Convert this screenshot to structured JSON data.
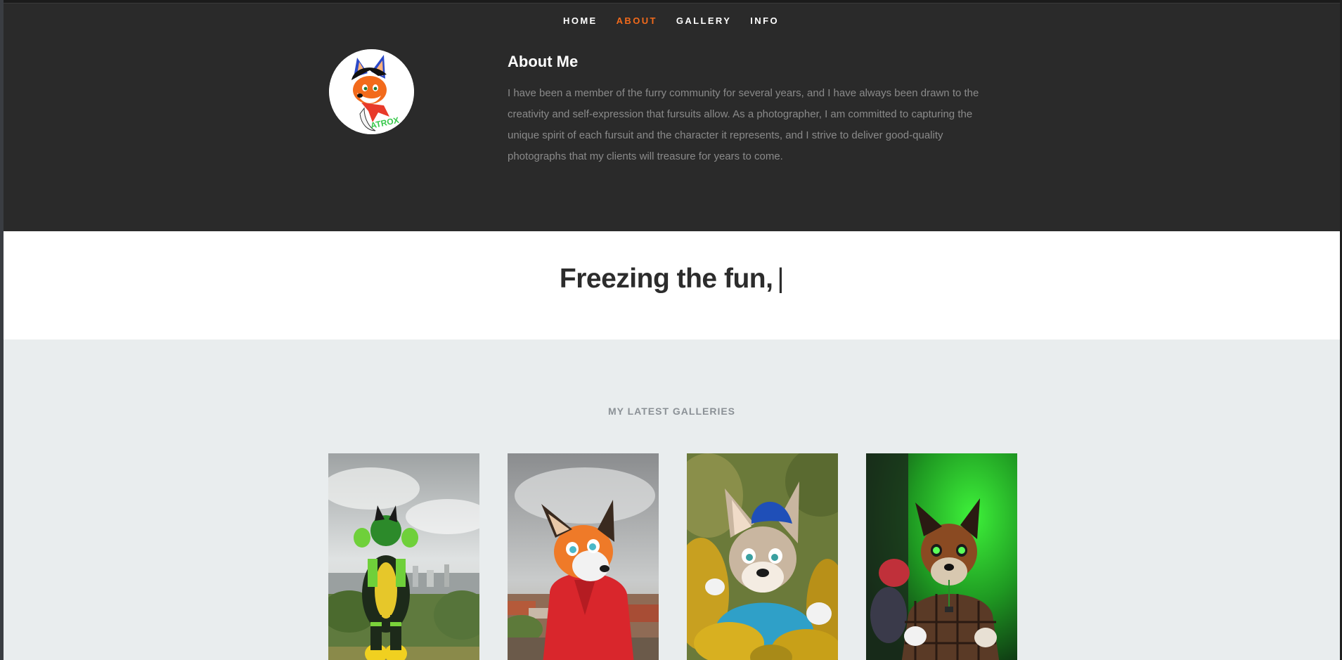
{
  "nav": {
    "items": [
      {
        "label": "HOME"
      },
      {
        "label": "ABOUT"
      },
      {
        "label": "GALLERY"
      },
      {
        "label": "INFO"
      }
    ]
  },
  "about": {
    "title": "About Me",
    "text": "I have been a member of the furry community for several years, and I have always been drawn to the creativity and self-expression that fursuits allow. As a photographer, I am committed to capturing the unique spirit of each fursuit and the character it represents, and I strive to deliver good-quality photographs that my clients will treasure for years to come.",
    "avatar_signature": "ATROX"
  },
  "tagline": {
    "text": "Freezing the fun,",
    "caret": "|"
  },
  "galleries": {
    "heading": "MY LATEST GALLERIES"
  },
  "colors": {
    "accent": "#f26a1b",
    "dark_bg": "#2a2a2a",
    "light_bg": "#e9edee"
  }
}
